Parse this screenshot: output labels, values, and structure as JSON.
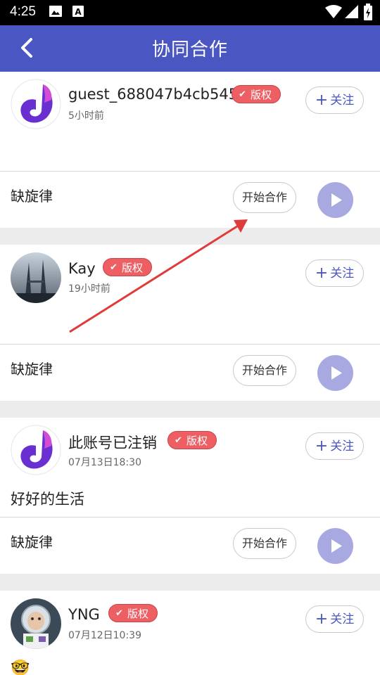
{
  "status_bar": {
    "time": "4:25"
  },
  "app_bar": {
    "title": "协同合作",
    "back_icon": "chevron-left-icon"
  },
  "posts": [
    {
      "username": "guest_688047b4cb545",
      "badge": "版权",
      "time": "5小时前",
      "follow_label": "关注",
      "text": "",
      "song_name": "缺旋律",
      "collab_label": "开始合作",
      "avatar": "app-logo"
    },
    {
      "username": "Kay",
      "badge": "版权",
      "time": "19小时前",
      "follow_label": "关注",
      "text": "",
      "song_name": "缺旋律",
      "collab_label": "开始合作",
      "avatar": "photo-towers"
    },
    {
      "username": "此账号已注销",
      "badge": "版权",
      "time": "07月13日18:30",
      "follow_label": "关注",
      "text": "好好的生活",
      "song_name": "缺旋律",
      "collab_label": "开始合作",
      "avatar": "app-logo"
    },
    {
      "username": "YNG",
      "badge": "版权",
      "time": "07月12日10:39",
      "follow_label": "关注",
      "text": "🤓",
      "avatar": "photo-toy"
    }
  ],
  "colors": {
    "appbar": "#4a57c2",
    "badge": "#ee5f63",
    "play": "#a8a9e1",
    "arrow": "#e03a3a"
  }
}
